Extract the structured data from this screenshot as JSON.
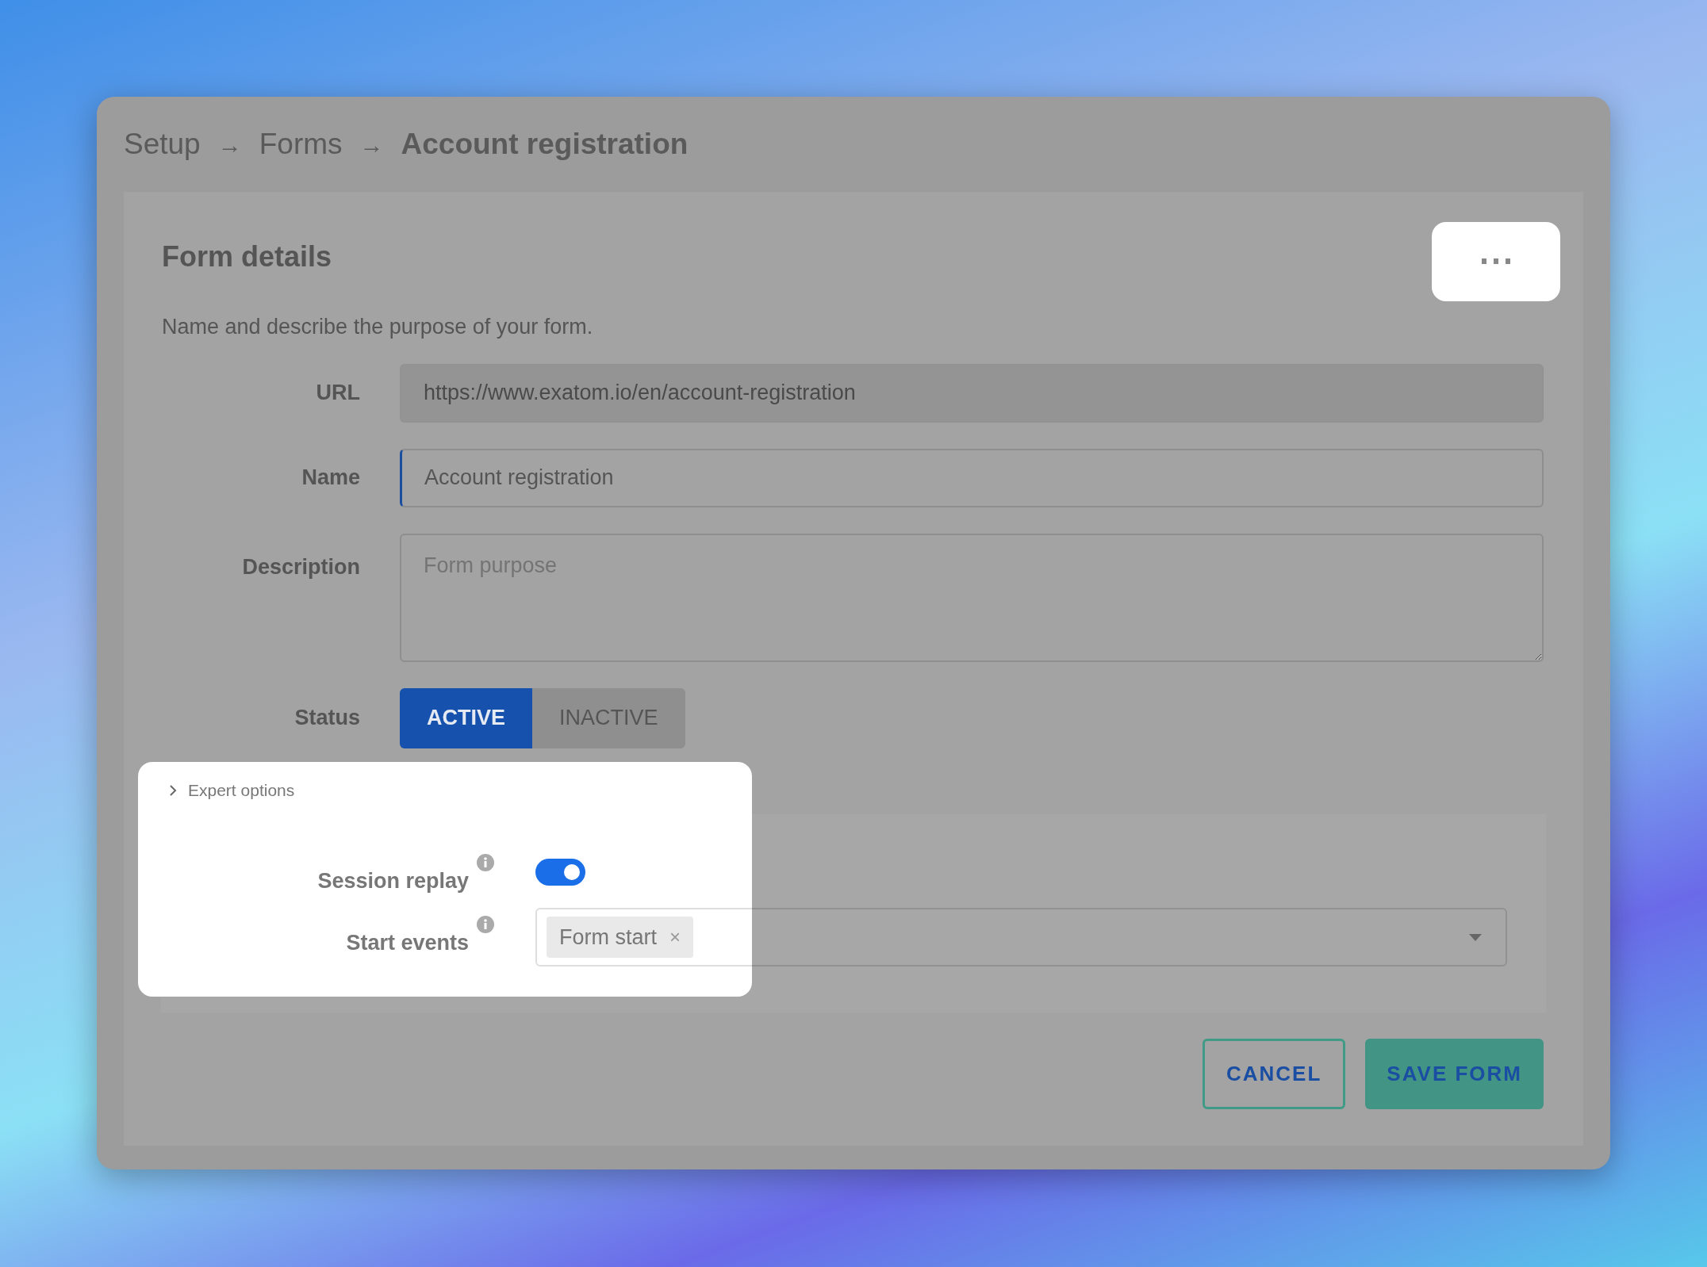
{
  "breadcrumb": [
    {
      "label": "Setup",
      "current": false
    },
    {
      "label": "Forms",
      "current": false,
      "separator": "→"
    },
    {
      "label": "Account registration",
      "current": true,
      "separator": "→"
    }
  ],
  "card": {
    "title": "Form details",
    "description": "Name and describe the purpose of your form."
  },
  "fields": [
    {
      "kind": "text",
      "label": "URL",
      "value": "https://www.exatom.io/en/account-registration",
      "disabled": true,
      "focused": false
    },
    {
      "kind": "text",
      "label": "Name",
      "value": "Account registration",
      "disabled": false,
      "focused": true
    },
    {
      "kind": "textarea",
      "label": "Description",
      "placeholder": "Form purpose"
    },
    {
      "kind": "segmented",
      "label": "Status",
      "options": [
        {
          "label": "ACTIVE",
          "selected": true
        },
        {
          "label": "INACTIVE",
          "selected": false
        }
      ]
    }
  ],
  "expert_options": {
    "label": "Expert options",
    "highlighted": true,
    "fields": [
      {
        "kind": "switch",
        "label": "Session replay",
        "info": true,
        "on": true
      },
      {
        "kind": "tags",
        "label": "Start events",
        "info": true,
        "tags": [
          {
            "label": "Form start",
            "remove": "×"
          }
        ]
      }
    ]
  },
  "buttons": [
    {
      "kind": "outline",
      "label": "CANCEL"
    },
    {
      "kind": "filled",
      "label": "SAVE FORM"
    }
  ]
}
